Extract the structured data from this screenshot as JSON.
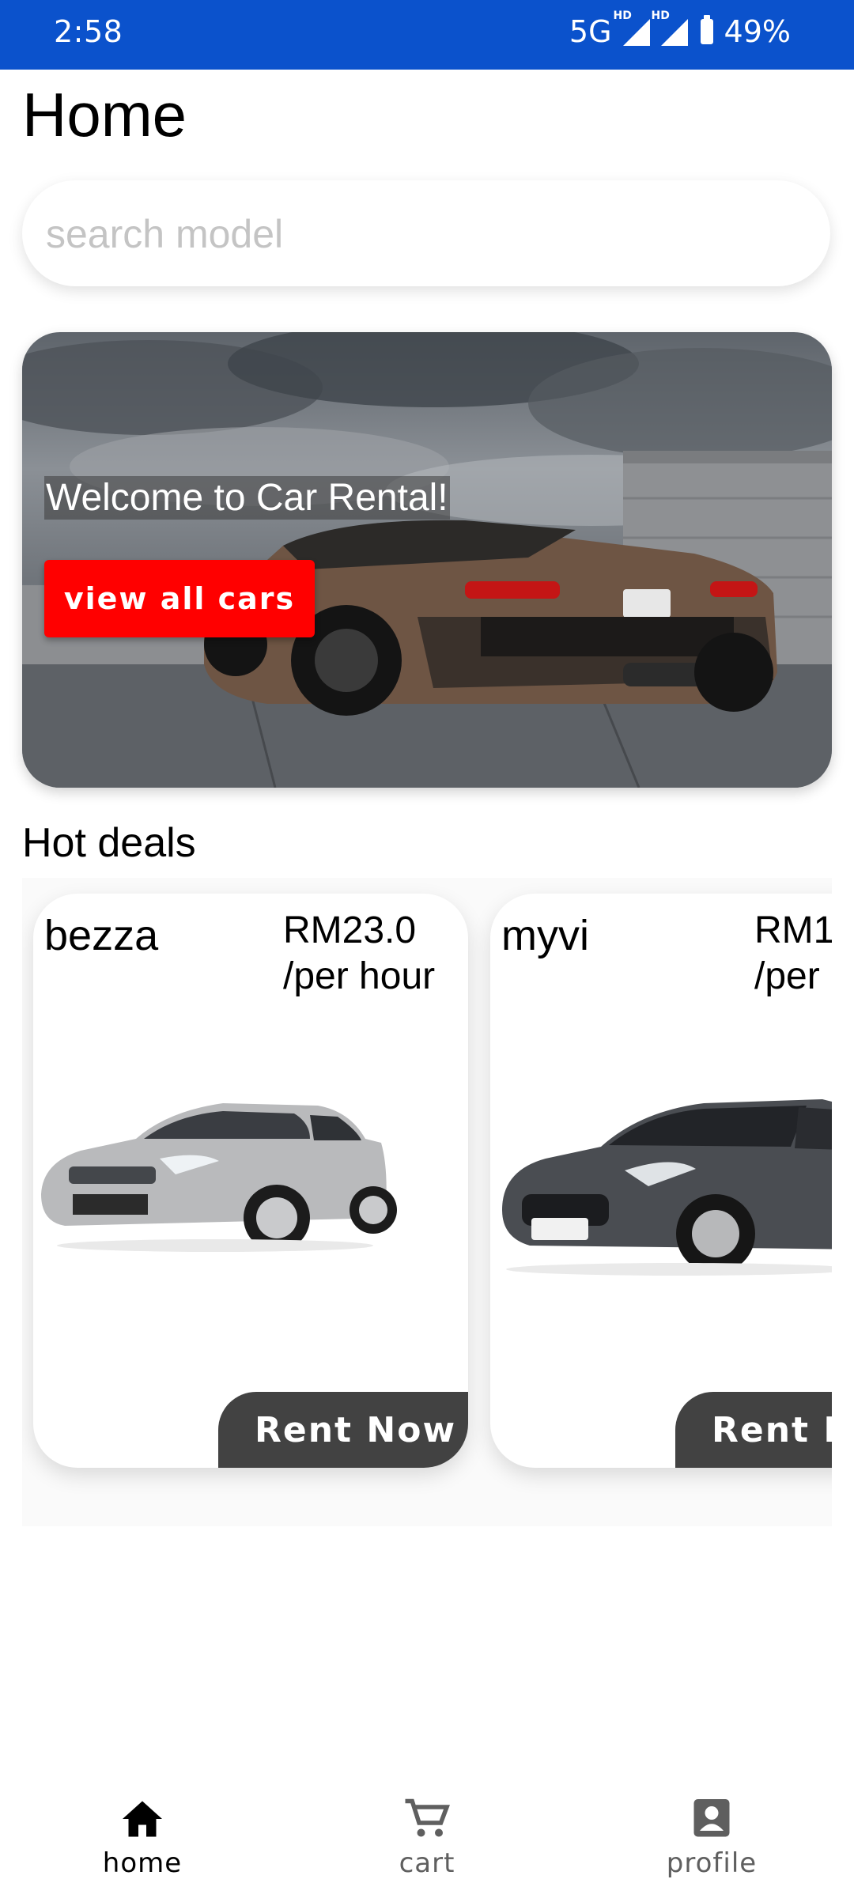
{
  "status_bar": {
    "time": "2:58",
    "network": "5G",
    "hd_1": "HD",
    "hd_2": "HD",
    "battery": "49%"
  },
  "header": {
    "title": "Home"
  },
  "search": {
    "placeholder": "search model",
    "value": ""
  },
  "banner": {
    "welcome_text": "Welcome to Car Rental!",
    "button_label": "view all cars"
  },
  "hot_deals": {
    "title": "Hot deals",
    "cards": [
      {
        "name": "bezza",
        "price": "RM23.0",
        "unit": "/per hour",
        "button_label": "Rent Now",
        "car_color": "#b9babc"
      },
      {
        "name": "myvi",
        "price": "RM1",
        "unit": "/per",
        "button_label": "Rent N",
        "car_color": "#4a4d52"
      }
    ]
  },
  "bottom_nav": {
    "items": [
      {
        "label": "home",
        "icon": "home-icon",
        "active": true
      },
      {
        "label": "cart",
        "icon": "cart-icon",
        "active": false
      },
      {
        "label": "profile",
        "icon": "profile-icon",
        "active": false
      }
    ]
  },
  "colors": {
    "status_bar": "#0b52cc",
    "cta_red": "#ff0000",
    "rent_button": "#424242",
    "nav_active": "#000000",
    "nav_inactive": "#5f5f5f"
  }
}
